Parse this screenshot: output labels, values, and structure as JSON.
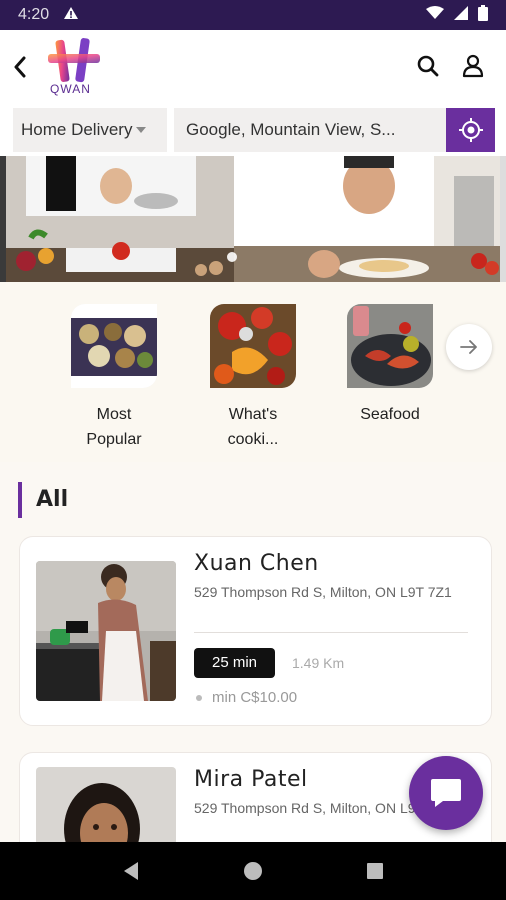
{
  "status_bar": {
    "time": "4:20",
    "icons": [
      "warning-icon",
      "wifi-icon",
      "signal-icon",
      "battery-icon"
    ]
  },
  "header": {
    "logo_text": "QWAN",
    "icons": [
      "back-arrow-icon",
      "search-icon",
      "user-icon"
    ]
  },
  "location_bar": {
    "delivery_mode": "Home Delivery",
    "address": "Google, Mountain View, S...",
    "locate_icon": "crosshair-icon"
  },
  "categories": [
    {
      "label": "Most Popular",
      "line1": "Most",
      "line2": "Popular"
    },
    {
      "label": "What's cooki...",
      "line1": "What's",
      "line2": "cooki..."
    },
    {
      "label": "Seafood",
      "line1": "Seafood",
      "line2": ""
    }
  ],
  "section": {
    "title": "All"
  },
  "restaurants": [
    {
      "name": "Xuan Chen",
      "address": "529 Thompson Rd S, Milton, ON L9T 7Z1",
      "time": "25 min",
      "distance": "1.49 Km",
      "min_order": "min C$10.00"
    },
    {
      "name": "Mira Patel",
      "address": "529 Thompson Rd S, Milton, ON L9T 7Z1r"
    }
  ],
  "colors": {
    "accent": "#6a2f9e",
    "status_bar": "#2d1a52",
    "background": "#fbf8f3"
  }
}
